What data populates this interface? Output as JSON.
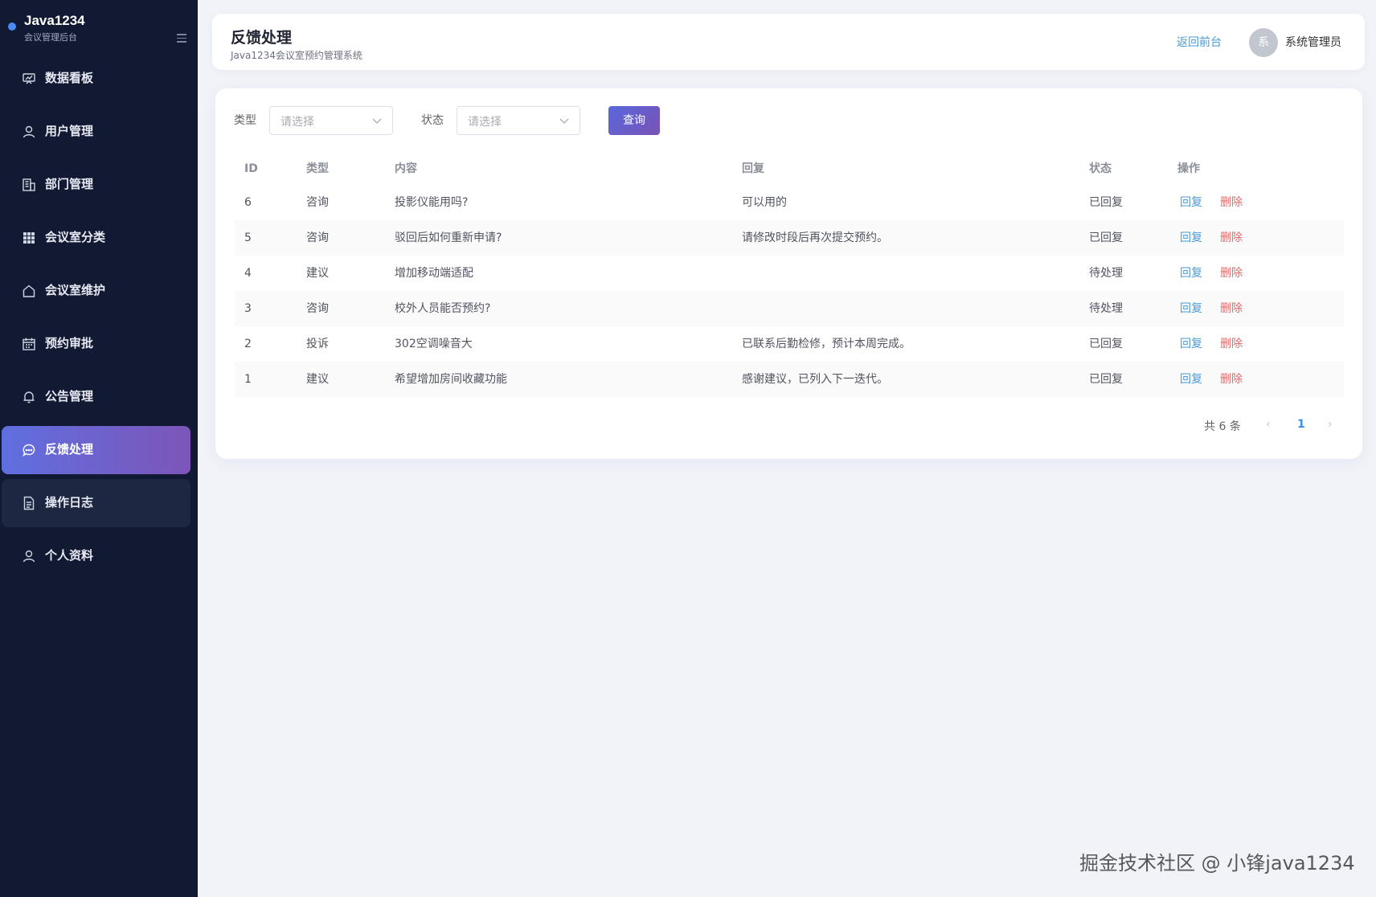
{
  "brand": {
    "title": "Java1234",
    "subtitle": "会议管理后台"
  },
  "sidebar": {
    "items": [
      {
        "label": "数据看板",
        "icon": "dashboard-icon"
      },
      {
        "label": "用户管理",
        "icon": "user-icon"
      },
      {
        "label": "部门管理",
        "icon": "building-icon"
      },
      {
        "label": "会议室分类",
        "icon": "grid-icon"
      },
      {
        "label": "会议室维护",
        "icon": "home-icon"
      },
      {
        "label": "预约审批",
        "icon": "calendar-icon"
      },
      {
        "label": "公告管理",
        "icon": "bell-icon"
      },
      {
        "label": "反馈处理",
        "icon": "chat-icon",
        "active": true
      },
      {
        "label": "操作日志",
        "icon": "document-icon"
      },
      {
        "label": "个人资料",
        "icon": "profile-icon"
      }
    ]
  },
  "header": {
    "title": "反馈处理",
    "subtitle": "Java1234会议室预约管理系统",
    "back_link": "返回前台",
    "avatar_text": "系",
    "user_name": "系统管理员"
  },
  "filters": {
    "type_label": "类型",
    "type_placeholder": "请选择",
    "status_label": "状态",
    "status_placeholder": "请选择",
    "query_button": "查询"
  },
  "table": {
    "columns": [
      "ID",
      "类型",
      "内容",
      "回复",
      "状态",
      "操作"
    ],
    "rows": [
      {
        "id": "6",
        "type": "咨询",
        "content": "投影仪能用吗?",
        "reply": "可以用的",
        "status": "已回复"
      },
      {
        "id": "5",
        "type": "咨询",
        "content": "驳回后如何重新申请?",
        "reply": "请修改时段后再次提交预约。",
        "status": "已回复"
      },
      {
        "id": "4",
        "type": "建议",
        "content": "增加移动端适配",
        "reply": "",
        "status": "待处理"
      },
      {
        "id": "3",
        "type": "咨询",
        "content": "校外人员能否预约?",
        "reply": "",
        "status": "待处理"
      },
      {
        "id": "2",
        "type": "投诉",
        "content": "302空调噪音大",
        "reply": "已联系后勤检修，预计本周完成。",
        "status": "已回复"
      },
      {
        "id": "1",
        "type": "建议",
        "content": "希望增加房间收藏功能",
        "reply": "感谢建议，已列入下一迭代。",
        "status": "已回复"
      }
    ],
    "action_reply": "回复",
    "action_delete": "删除"
  },
  "pagination": {
    "total": "共 6 条",
    "current_page": "1"
  },
  "watermark": "掘金技术社区 @ 小锋java1234",
  "colors": {
    "sidebar_bg": "#121a33",
    "accent_gradient_start": "#5f6fe0",
    "accent_gradient_end": "#7d55b8",
    "link_blue": "#4a9ad8",
    "delete_red": "#e06a6a"
  }
}
